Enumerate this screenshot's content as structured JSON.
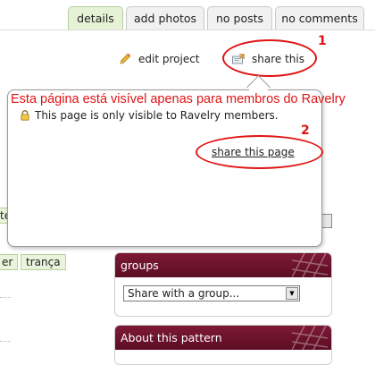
{
  "tabs": {
    "details": "details",
    "add_photos": "add photos",
    "no_posts": "no posts",
    "no_comments": "no comments"
  },
  "actions": {
    "edit_project": "edit project",
    "share_this": "share this"
  },
  "annotations": {
    "number_1": "1",
    "number_2": "2",
    "caption": "Esta página está visível apenas para membros do Ravelry"
  },
  "popup": {
    "notice": "This page is only visible to Ravelry members.",
    "share_page_link": "share this page"
  },
  "chips": {
    "left_partial": "er",
    "tranca": "trança",
    "hidden_partial": "te"
  },
  "groups_box": {
    "title": "groups",
    "select_value": "Share with a group..."
  },
  "pattern_box": {
    "title": "About this pattern"
  },
  "colors": {
    "annotation_red": "#e01414",
    "tab_active_bg": "#e6f2d5",
    "box_header": "#6b1229",
    "chip_bg": "#eaf4dd"
  }
}
